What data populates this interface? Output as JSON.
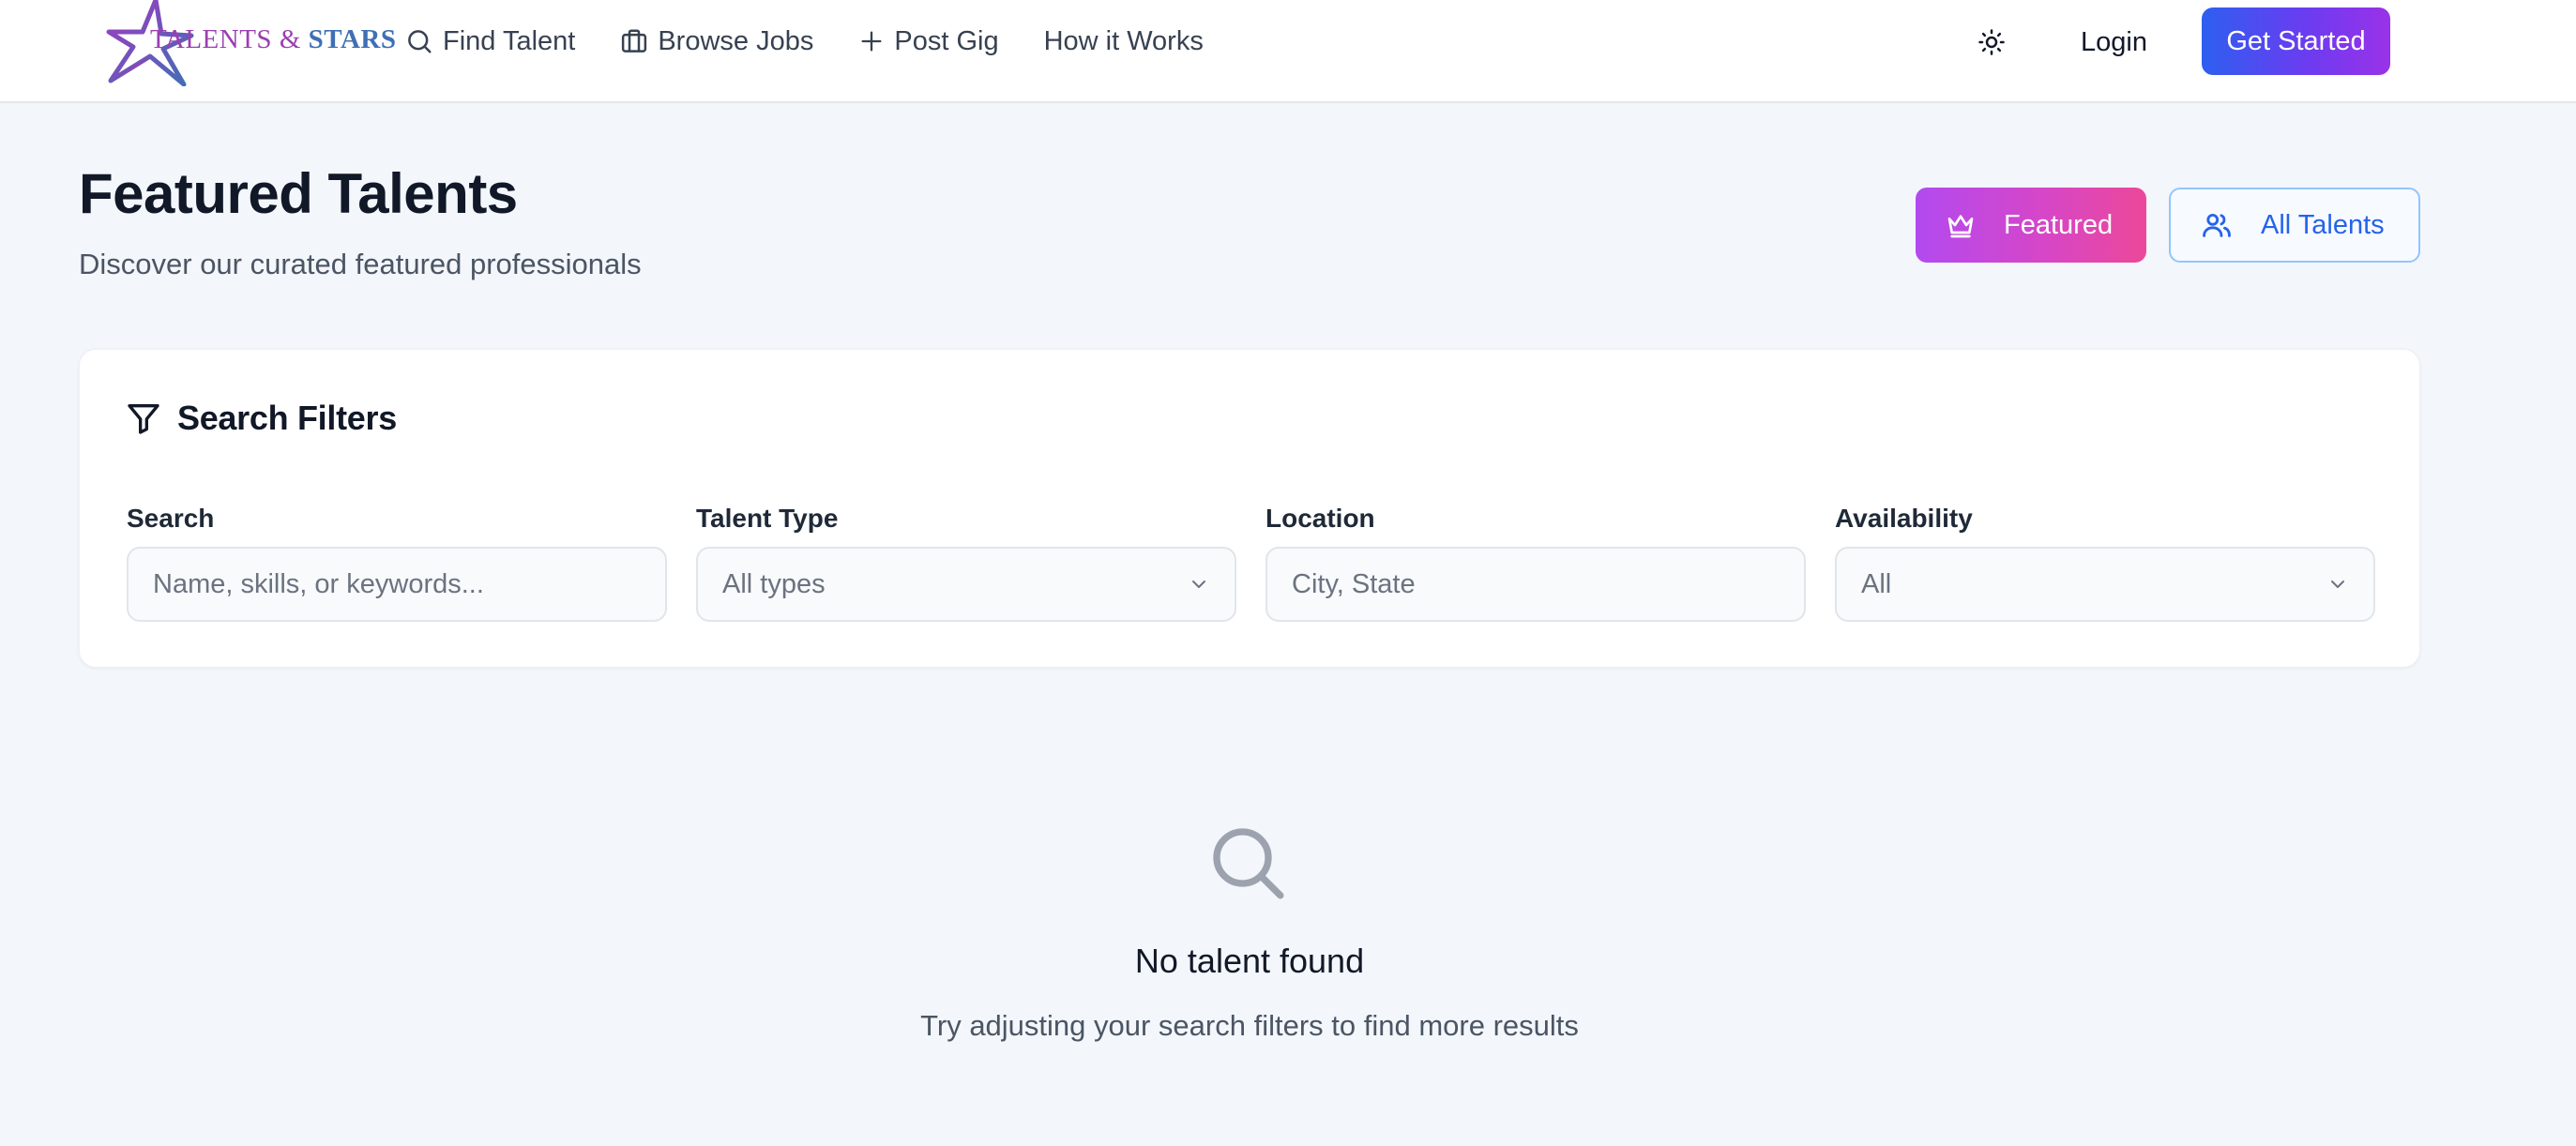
{
  "brand": {
    "word1": "TALENTS",
    "amp": "&",
    "word2": "STARS"
  },
  "nav": {
    "items": [
      {
        "label": "Find Talent",
        "icon": "search-icon"
      },
      {
        "label": "Browse Jobs",
        "icon": "briefcase-icon"
      },
      {
        "label": "Post Gig",
        "icon": "plus-icon"
      },
      {
        "label": "How it Works",
        "icon": ""
      }
    ]
  },
  "header": {
    "theme_icon": "sun-icon",
    "login_label": "Login",
    "get_started_label": "Get Started"
  },
  "page": {
    "title": "Featured Talents",
    "subtitle": "Discover our curated featured professionals",
    "featured_label": "Featured",
    "all_label": "All Talents"
  },
  "filters": {
    "title": "Search Filters",
    "search": {
      "label": "Search",
      "placeholder": "Name, skills, or keywords...",
      "value": ""
    },
    "talent_type": {
      "label": "Talent Type",
      "selected": "All types"
    },
    "location": {
      "label": "Location",
      "placeholder": "City, State",
      "value": ""
    },
    "availability": {
      "label": "Availability",
      "selected": "All"
    }
  },
  "empty_state": {
    "title": "No talent found",
    "message": "Try adjusting your search filters to find more results"
  },
  "colors": {
    "primary_gradient": [
      "#2d5ff0",
      "#9a32e8"
    ],
    "featured_gradient": [
      "#b24af0",
      "#ec4899"
    ],
    "accent_blue": "#2563eb",
    "page_bg": "#f3f6fb"
  }
}
